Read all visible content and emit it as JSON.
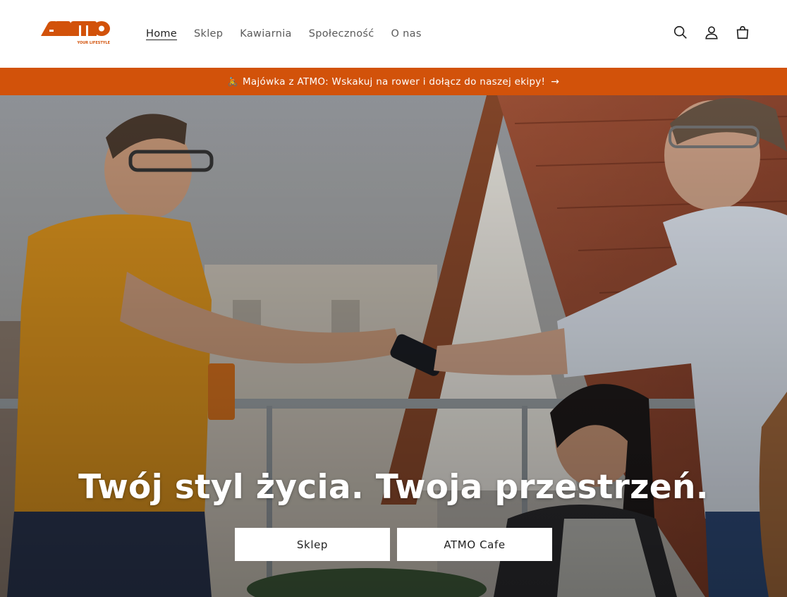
{
  "header": {
    "logo_text": "ATMO",
    "logo_tagline": "YOUR LIFESTYLE",
    "nav": [
      {
        "label": "Home"
      },
      {
        "label": "Sklep"
      },
      {
        "label": "Kawiarnia"
      },
      {
        "label": "Społeczność"
      },
      {
        "label": "O nas"
      }
    ],
    "icons": [
      "search-icon",
      "account-icon",
      "cart-icon"
    ]
  },
  "announcement": {
    "icon": "🚴",
    "text": "Majówka z ATMO: Wskakuj na rower i dołącz do naszej ekipy!",
    "arrow": "→"
  },
  "hero": {
    "title": "Twój styl życia. Twoja przestrzeń.",
    "buttons": [
      {
        "label": "Sklep"
      },
      {
        "label": "ATMO Cafe"
      }
    ]
  },
  "colors": {
    "brand": "#d2520a",
    "text": "#222222",
    "nav_text": "#5a5a5a"
  }
}
